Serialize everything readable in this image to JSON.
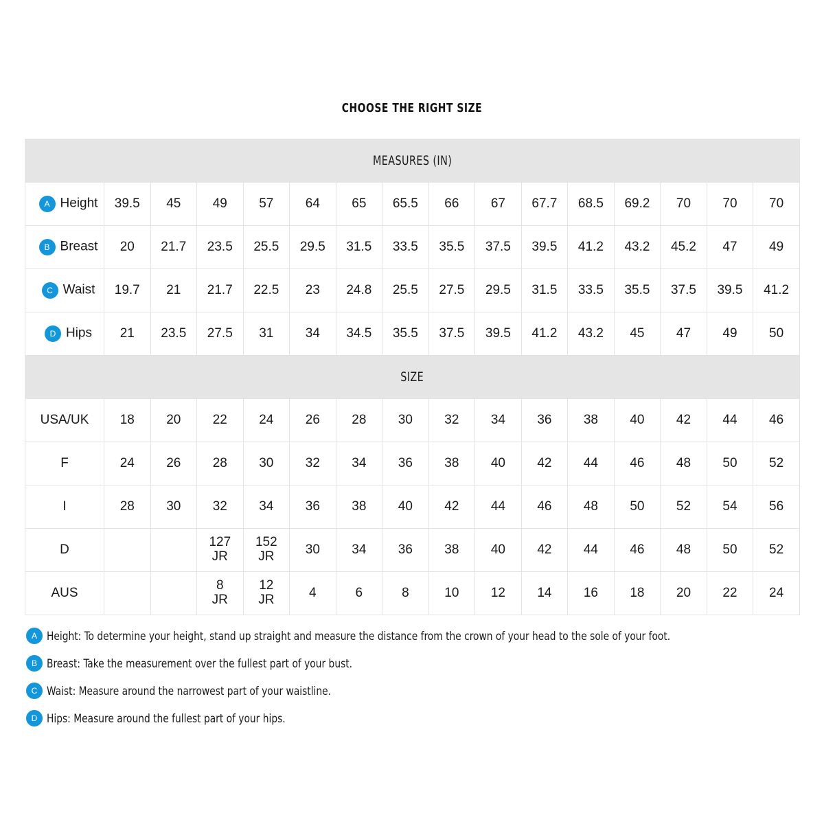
{
  "title": "CHOOSE THE RIGHT SIZE",
  "accent_color": "#1496da",
  "section_header_bg": "#e5e5e5",
  "sections": {
    "measures": {
      "header": "MEASURES (IN)",
      "rows": [
        {
          "badge": "A",
          "label": "Height",
          "values": [
            "39.5",
            "45",
            "49",
            "57",
            "64",
            "65",
            "65.5",
            "66",
            "67",
            "67.7",
            "68.5",
            "69.2",
            "70",
            "70",
            "70"
          ]
        },
        {
          "badge": "B",
          "label": "Breast",
          "values": [
            "20",
            "21.7",
            "23.5",
            "25.5",
            "29.5",
            "31.5",
            "33.5",
            "35.5",
            "37.5",
            "39.5",
            "41.2",
            "43.2",
            "45.2",
            "47",
            "49"
          ]
        },
        {
          "badge": "C",
          "label": "Waist",
          "values": [
            "19.7",
            "21",
            "21.7",
            "22.5",
            "23",
            "24.8",
            "25.5",
            "27.5",
            "29.5",
            "31.5",
            "33.5",
            "35.5",
            "37.5",
            "39.5",
            "41.2"
          ]
        },
        {
          "badge": "D",
          "label": "Hips",
          "values": [
            "21",
            "23.5",
            "27.5",
            "31",
            "34",
            "34.5",
            "35.5",
            "37.5",
            "39.5",
            "41.2",
            "43.2",
            "45",
            "47",
            "49",
            "50"
          ]
        }
      ]
    },
    "size": {
      "header": "SIZE",
      "rows": [
        {
          "badge": "",
          "label": "USA/UK",
          "values": [
            "18",
            "20",
            "22",
            "24",
            "26",
            "28",
            "30",
            "32",
            "34",
            "36",
            "38",
            "40",
            "42",
            "44",
            "46"
          ]
        },
        {
          "badge": "",
          "label": "F",
          "values": [
            "24",
            "26",
            "28",
            "30",
            "32",
            "34",
            "36",
            "38",
            "40",
            "42",
            "44",
            "46",
            "48",
            "50",
            "52"
          ]
        },
        {
          "badge": "",
          "label": "I",
          "values": [
            "28",
            "30",
            "32",
            "34",
            "36",
            "38",
            "40",
            "42",
            "44",
            "46",
            "48",
            "50",
            "52",
            "54",
            "56"
          ]
        },
        {
          "badge": "",
          "label": "D",
          "values": [
            "",
            "",
            "127 JR",
            "152 JR",
            "30",
            "34",
            "36",
            "38",
            "40",
            "42",
            "44",
            "46",
            "48",
            "50",
            "52"
          ]
        },
        {
          "badge": "",
          "label": "AUS",
          "values": [
            "",
            "",
            "8 JR",
            "12 JR",
            "4",
            "6",
            "8",
            "10",
            "12",
            "14",
            "16",
            "18",
            "20",
            "22",
            "24"
          ]
        }
      ]
    }
  },
  "legend": [
    {
      "badge": "A",
      "text": "Height: To determine your height, stand up straight and measure the distance from the crown of your head to the sole of your foot."
    },
    {
      "badge": "B",
      "text": "Breast: Take the measurement over the fullest part of your bust."
    },
    {
      "badge": "C",
      "text": "Waist: Measure around the narrowest part of your waistline."
    },
    {
      "badge": "D",
      "text": "Hips: Measure around the fullest part of your hips."
    }
  ]
}
